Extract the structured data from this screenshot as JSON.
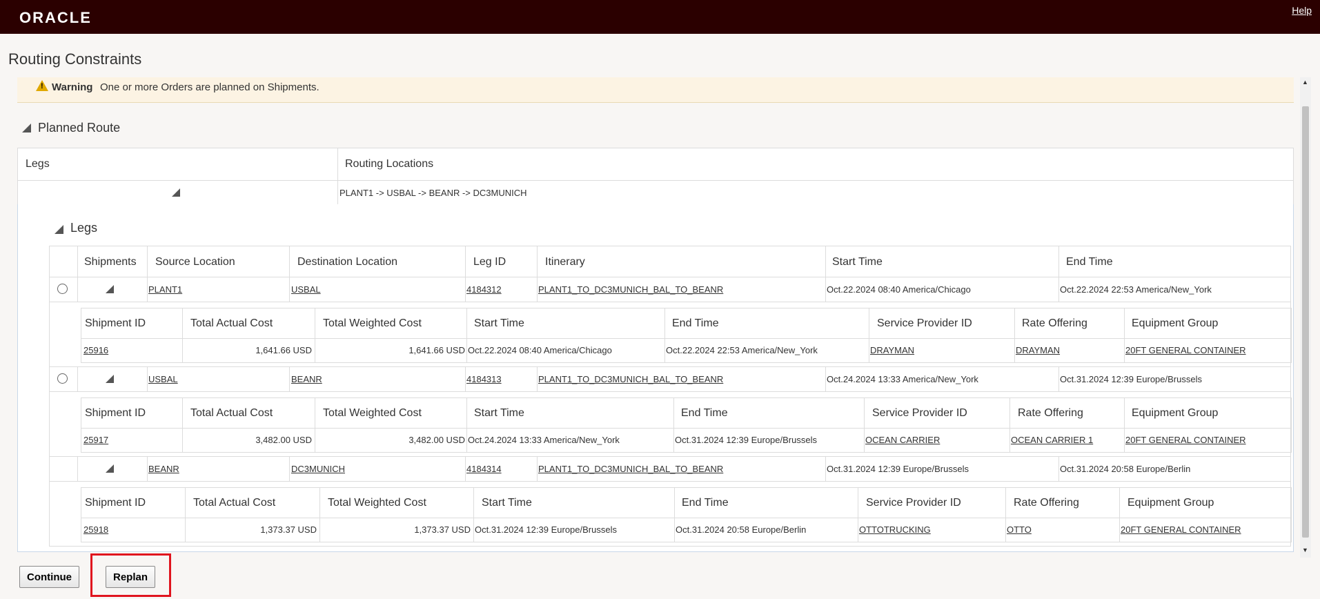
{
  "header": {
    "logo": "ORACLE",
    "help": "Help"
  },
  "page": {
    "title": "Routing Constraints"
  },
  "warning": {
    "label": "Warning",
    "message": "One or more Orders are planned on Shipments."
  },
  "planned_route": {
    "title": "Planned Route",
    "columns": {
      "legs": "Legs",
      "routing_locations": "Routing Locations"
    },
    "row": {
      "routing_locations": "PLANT1 -> USBAL -> BEANR -> DC3MUNICH"
    }
  },
  "legs": {
    "title": "Legs",
    "columns": {
      "shipments": "Shipments",
      "source": "Source Location",
      "destination": "Destination Location",
      "leg_id": "Leg ID",
      "itinerary": "Itinerary",
      "start": "Start Time",
      "end": "End Time"
    },
    "sub_columns": {
      "shipment_id": "Shipment ID",
      "actual_cost": "Total Actual Cost",
      "weighted_cost": "Total Weighted Cost",
      "start": "Start Time",
      "end": "End Time",
      "provider": "Service Provider ID",
      "rate": "Rate Offering",
      "equipment": "Equipment Group"
    },
    "rows": [
      {
        "source": "PLANT1",
        "destination": "USBAL",
        "leg_id": "4184312",
        "itinerary": "PLANT1_TO_DC3MUNICH_BAL_TO_BEANR",
        "start": "Oct.22.2024 08:40 America/Chicago",
        "end": "Oct.22.2024 22:53 America/New_York",
        "shipment": {
          "id": "25916",
          "actual_cost": "1,641.66 USD",
          "weighted_cost": "1,641.66 USD",
          "start": "Oct.22.2024 08:40 America/Chicago",
          "end": "Oct.22.2024 22:53 America/New_York",
          "provider": "DRAYMAN",
          "rate": "DRAYMAN",
          "equipment": "20FT GENERAL CONTAINER"
        }
      },
      {
        "source": "USBAL",
        "destination": "BEANR",
        "leg_id": "4184313",
        "itinerary": "PLANT1_TO_DC3MUNICH_BAL_TO_BEANR",
        "start": "Oct.24.2024 13:33 America/New_York",
        "end": "Oct.31.2024 12:39 Europe/Brussels",
        "shipment": {
          "id": "25917",
          "actual_cost": "3,482.00 USD",
          "weighted_cost": "3,482.00 USD",
          "start": "Oct.24.2024 13:33 America/New_York",
          "end": "Oct.31.2024 12:39 Europe/Brussels",
          "provider": "OCEAN CARRIER",
          "rate": "OCEAN CARRIER 1",
          "equipment": "20FT GENERAL CONTAINER"
        }
      },
      {
        "source": "BEANR",
        "destination": "DC3MUNICH",
        "leg_id": "4184314",
        "itinerary": "PLANT1_TO_DC3MUNICH_BAL_TO_BEANR",
        "start": "Oct.31.2024 12:39 Europe/Brussels",
        "end": "Oct.31.2024 20:58 Europe/Berlin",
        "shipment": {
          "id": "25918",
          "actual_cost": "1,373.37 USD",
          "weighted_cost": "1,373.37 USD",
          "start": "Oct.31.2024 12:39 Europe/Brussels",
          "end": "Oct.31.2024 20:58 Europe/Berlin",
          "provider": "OTTOTRUCKING",
          "rate": "OTTO",
          "equipment": "20FT GENERAL CONTAINER"
        }
      }
    ]
  },
  "buttons": {
    "continue": "Continue",
    "replan": "Replan"
  },
  "colors": {
    "brand_bar": "#2b0000",
    "link": "#1f5b9a",
    "highlight": "#e0141e",
    "warning_bg": "#fcf3e3"
  }
}
